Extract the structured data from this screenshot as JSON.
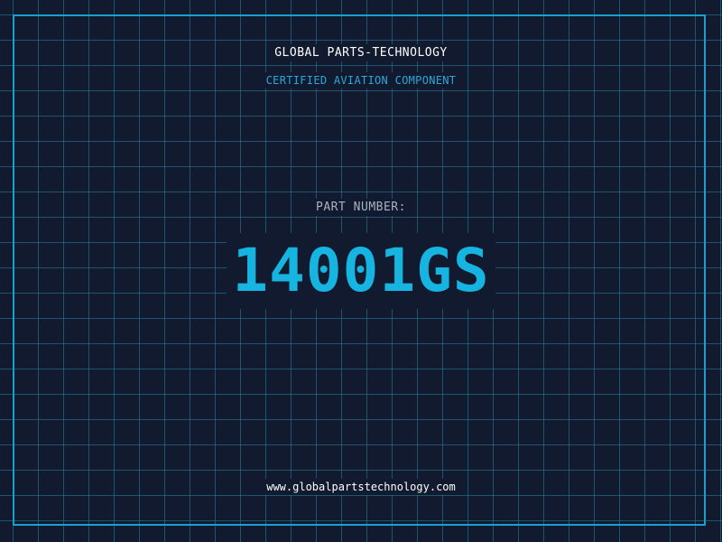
{
  "header": {
    "company_name": "GLOBAL PARTS-TECHNOLOGY",
    "subtitle": "CERTIFIED AVIATION COMPONENT"
  },
  "part": {
    "label": "PART NUMBER:",
    "number": "14001GS"
  },
  "footer": {
    "website": "www.globalpartstechnology.com"
  },
  "colors": {
    "background": "#111a2e",
    "grid": "#28829f",
    "border": "#1aa0cf",
    "accent": "#16b4e0",
    "label": "#a7b3c4",
    "text": "#ffffff"
  }
}
